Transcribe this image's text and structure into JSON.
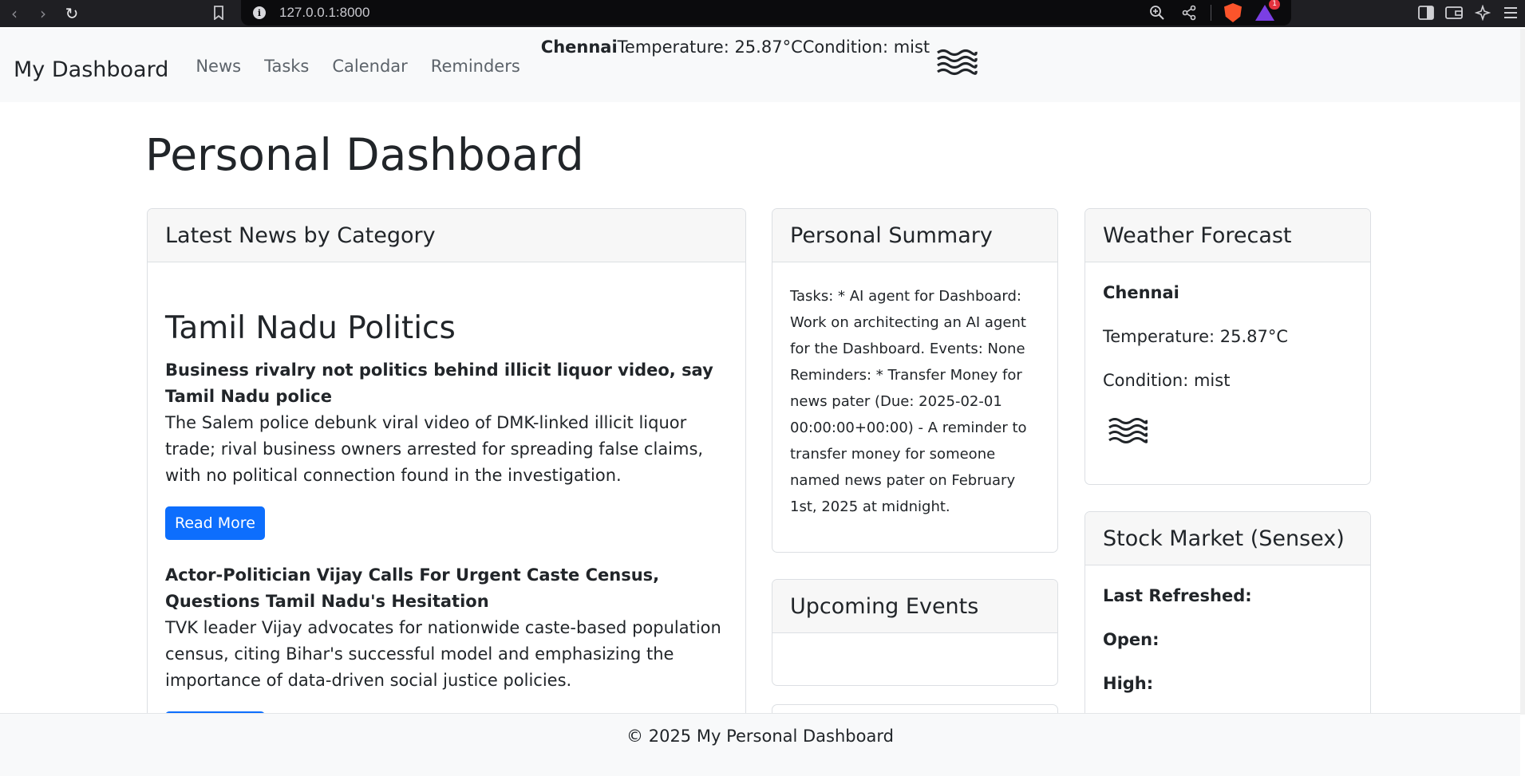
{
  "browser": {
    "url": "127.0.0.1:8000",
    "rewards_badge": "1"
  },
  "navbar": {
    "brand": "My Dashboard",
    "links": [
      "News",
      "Tasks",
      "Calendar",
      "Reminders"
    ],
    "weather_city": "Chennai",
    "weather_temp": "Temperature: 25.87°C",
    "weather_condition": "Condition: mist",
    "weather_icon": "mist-icon"
  },
  "page": {
    "title": "Personal Dashboard"
  },
  "news_card": {
    "header": "Latest News by Category",
    "category": "Tamil Nadu Politics",
    "read_more": "Read More",
    "items": [
      {
        "title": "Business rivalry not politics behind illicit liquor video, say Tamil Nadu police",
        "description": "The Salem police debunk viral video of DMK-linked illicit liquor trade; rival business owners arrested for spreading false claims, with no political connection found in the investigation."
      },
      {
        "title": "Actor-Politician Vijay Calls For Urgent Caste Census, Questions Tamil Nadu's Hesitation",
        "description": "TVK leader Vijay advocates for nationwide caste-based population census, citing Bihar's successful model and emphasizing the importance of data-driven social justice policies."
      }
    ]
  },
  "summary_card": {
    "header": "Personal Summary",
    "text": "Tasks: * AI agent for Dashboard: Work on architecting an AI agent for the Dashboard. Events: None Reminders: * Transfer Money for news pater (Due: 2025-02-01 00:00:00+00:00) - A reminder to transfer money for someone named news pater on February 1st, 2025 at midnight."
  },
  "events_card": {
    "header": "Upcoming Events"
  },
  "weather_card": {
    "header": "Weather Forecast",
    "city": "Chennai",
    "temperature": "Temperature: 25.87°C",
    "condition": "Condition: mist",
    "icon": "mist-icon"
  },
  "stock_card": {
    "header": "Stock Market (Sensex)",
    "labels": [
      "Last Refreshed:",
      "Open:",
      "High:"
    ]
  },
  "footer": {
    "text": "© 2025 My Personal Dashboard"
  },
  "colors": {
    "primary": "#0d6efd",
    "navbar_bg": "#f8f9fa",
    "browser_bar": "#1f1f23",
    "brave_orange": "#fb542b"
  }
}
